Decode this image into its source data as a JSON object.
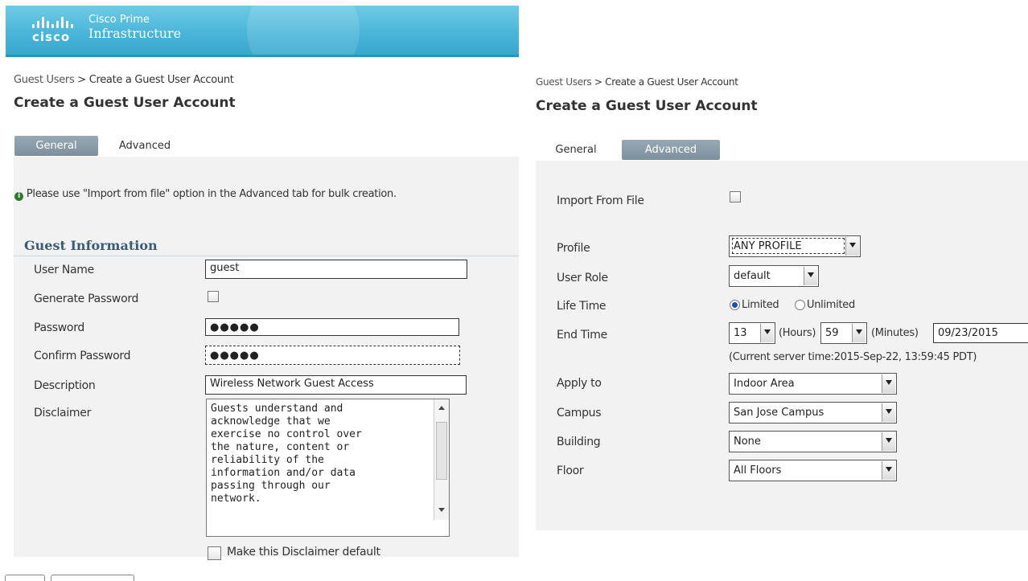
{
  "header": {
    "logo_text": "cisco",
    "product_line1": "Cisco Prime",
    "product_line2": "Infrastructure"
  },
  "left": {
    "breadcrumb": {
      "parent": "Guest Users",
      "sep": ">",
      "current": "Create a Guest User Account"
    },
    "title": "Create a Guest User Account",
    "tabs": [
      {
        "label": "General",
        "active": true
      },
      {
        "label": "Advanced",
        "active": false
      }
    ],
    "info_text": "Please use \"Import from file\" option in the Advanced tab for bulk creation.",
    "section_title": "Guest Information",
    "fields": {
      "user_name": {
        "label": "User Name",
        "value": "guest"
      },
      "generate_password": {
        "label": "Generate Password",
        "checked": false
      },
      "password": {
        "label": "Password",
        "value": "●●●●●"
      },
      "confirm_password": {
        "label": "Confirm Password",
        "value": "●●●●●"
      },
      "description": {
        "label": "Description",
        "value": "Wireless Network Guest Access"
      },
      "disclaimer": {
        "label": "Disclaimer",
        "value": "Guests understand and\nacknowledge that we\nexercise no control over\nthe nature, content or\nreliability of the\ninformation and/or data\npassing through our\nnetwork."
      },
      "make_default": {
        "label": "Make this Disclaimer default",
        "checked": false
      }
    }
  },
  "right": {
    "breadcrumb": {
      "parent": "Guest Users",
      "sep": ">",
      "current": "Create a Guest User Account"
    },
    "title": "Create a Guest User Account",
    "tabs": [
      {
        "label": "General",
        "active": false
      },
      {
        "label": "Advanced",
        "active": true
      }
    ],
    "fields": {
      "import_from_file": {
        "label": "Import From File",
        "checked": false
      },
      "profile": {
        "label": "Profile",
        "value": "ANY PROFILE"
      },
      "user_role": {
        "label": "User Role",
        "value": "default"
      },
      "life_time": {
        "label": "Life Time",
        "options": [
          "Limited",
          "Unlimited"
        ],
        "selected": "Limited"
      },
      "end_time": {
        "label": "End Time",
        "hours": "13",
        "hours_label": "(Hours)",
        "minutes": "59",
        "minutes_label": "(Minutes)",
        "date": "09/23/2015"
      },
      "server_time": "(Current server time:2015-Sep-22, 13:59:45 PDT)",
      "apply_to": {
        "label": "Apply to",
        "value": "Indoor Area"
      },
      "campus": {
        "label": "Campus",
        "value": "San Jose Campus"
      },
      "building": {
        "label": "Building",
        "value": "None"
      },
      "floor": {
        "label": "Floor",
        "value": "All Floors"
      }
    }
  },
  "colors": {
    "header": "#48b4d8",
    "tab_active": "#8a9ca9",
    "section_title": "#3b5b78",
    "panel": "#f2f2f2",
    "info_icon": "#2d7a2d"
  },
  "icons": [
    "info-icon",
    "checkbox",
    "radio",
    "dropdown-arrow-icon",
    "scroll-up-icon",
    "scroll-down-icon"
  ]
}
